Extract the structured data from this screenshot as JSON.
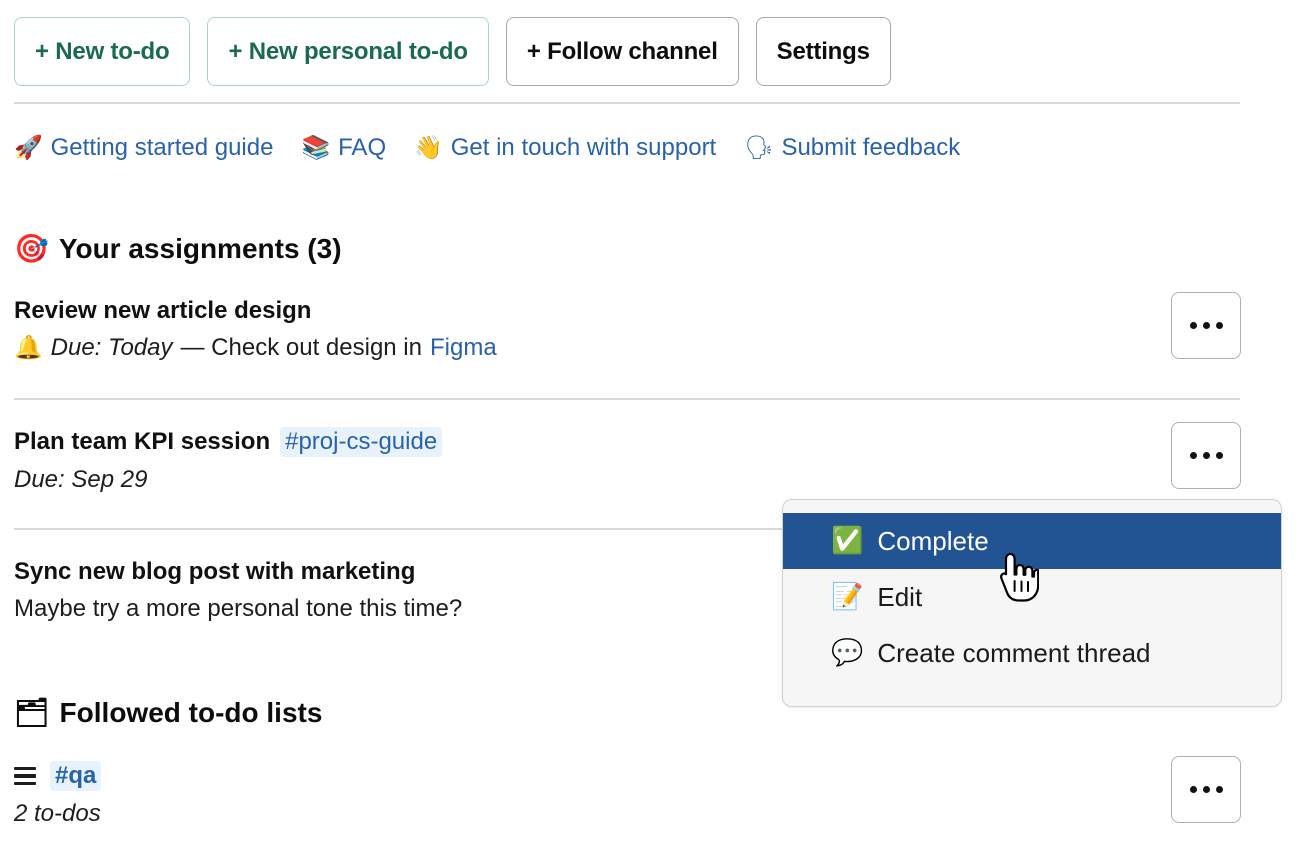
{
  "toolbar": {
    "buttons": [
      {
        "label": "+ New to-do",
        "style": "green"
      },
      {
        "label": "+ New personal to-do",
        "style": "green"
      },
      {
        "label": "+ Follow channel",
        "style": "grey"
      },
      {
        "label": "Settings",
        "style": "grey"
      }
    ]
  },
  "help_links": [
    {
      "icon": "rocket-icon",
      "emoji": "🚀",
      "label": "Getting started guide"
    },
    {
      "icon": "books-icon",
      "emoji": "📚",
      "label": "FAQ"
    },
    {
      "icon": "waving-hand-icon",
      "emoji": "👋",
      "label": "Get in touch with support"
    },
    {
      "icon": "speaking-head-icon",
      "emoji": "🗣",
      "label": "Submit feedback"
    }
  ],
  "assignments": {
    "icon": "direct-hit-icon",
    "emoji": "🎯",
    "heading": "Your assignments (3)",
    "count": 3,
    "items": [
      {
        "title": "Review new article design",
        "channel": "",
        "sub_emoji": "🔔",
        "sub_icon": "bell-icon",
        "sub_italic": "Due: Today",
        "sub_plain": "— Check out design in",
        "sub_link": "Figma",
        "overflow_label": "…"
      },
      {
        "title": "Plan team KPI session",
        "channel": "#proj-cs-guide",
        "sub_emoji": "",
        "sub_icon": "",
        "sub_italic": "Due: Sep 29",
        "sub_plain": "",
        "sub_link": "",
        "overflow_label": "…"
      },
      {
        "title": "Sync new blog post with marketing",
        "channel": "",
        "sub_emoji": "",
        "sub_icon": "",
        "sub_italic": "",
        "sub_plain": "Maybe try a more personal tone this time?",
        "sub_link": "",
        "overflow_label": "…"
      }
    ]
  },
  "followed": {
    "icon": "card-index-dividers-icon",
    "emoji": "🗂",
    "heading": "Followed to-do lists",
    "items": [
      {
        "list_icon": "hamburger-icon",
        "channel": "#qa",
        "count_label": "2 to-dos",
        "overflow_label": "…"
      }
    ]
  },
  "context_menu": {
    "items": [
      {
        "emoji": "✅",
        "icon": "check-mark-button-icon",
        "label": "Complete",
        "selected": true
      },
      {
        "emoji": "📝",
        "icon": "memo-icon",
        "label": "Edit",
        "selected": false
      },
      {
        "emoji": "💬",
        "icon": "speech-balloon-icon",
        "label": "Create comment thread",
        "selected": false
      }
    ]
  },
  "cursor": {
    "type": "pointing-hand-cursor"
  },
  "colors": {
    "accent_green": "#1a6b4d",
    "link_blue": "#2a62a8",
    "menu_selected": "#225493",
    "chip_bg": "#e8f2fb",
    "divider": "#d9d9d9"
  }
}
